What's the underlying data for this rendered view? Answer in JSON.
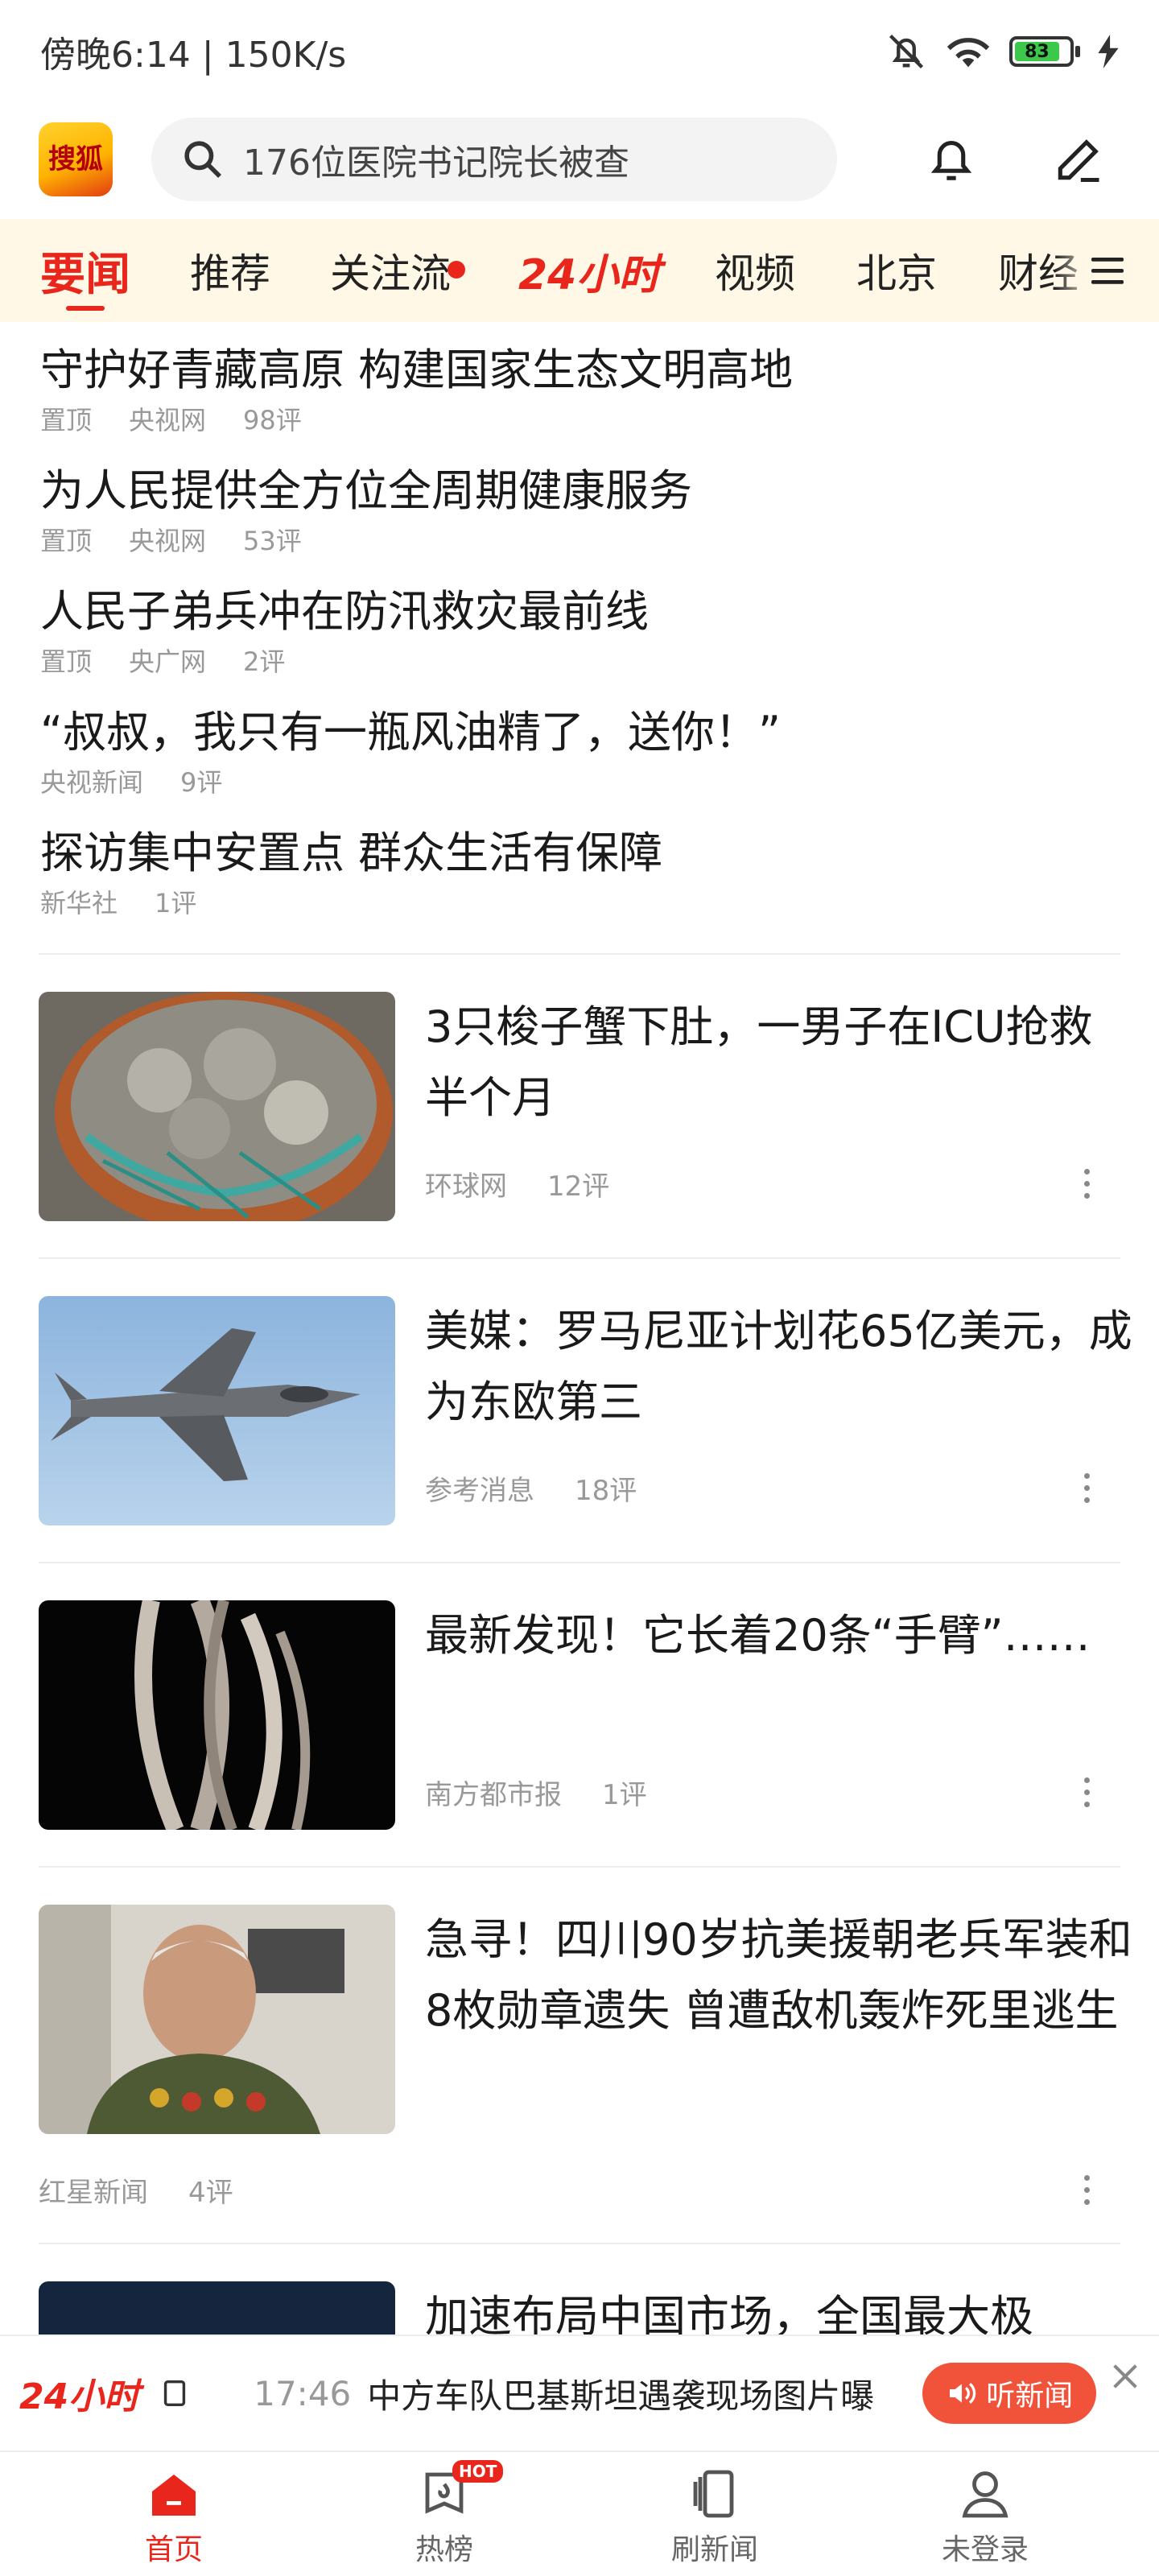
{
  "status_bar": {
    "left": "傍晚6:14 | 150K/s",
    "battery": "83"
  },
  "header": {
    "logo_text": "搜狐",
    "search_placeholder": "176位医院书记院长被查"
  },
  "tabs": [
    {
      "label": "要闻",
      "active": true
    },
    {
      "label": "推荐"
    },
    {
      "label": "关注流",
      "has_dot": true
    },
    {
      "label": "24小时",
      "styled": true
    },
    {
      "label": "视频"
    },
    {
      "label": "北京"
    },
    {
      "label": "财经"
    }
  ],
  "top_stories": [
    {
      "title": "守护好青藏高原 构建国家生态文明高地",
      "pin": "置顶",
      "source": "央视网",
      "comments": "98评"
    },
    {
      "title": "为人民提供全方位全周期健康服务",
      "pin": "置顶",
      "source": "央视网",
      "comments": "53评"
    },
    {
      "title": "人民子弟兵冲在防汛救灾最前线",
      "pin": "置顶",
      "source": "央广网",
      "comments": "2评"
    },
    {
      "title": "“叔叔，我只有一瓶风油精了，送你！”",
      "source": "央视新闻",
      "comments": "9评"
    },
    {
      "title": "探访集中安置点 群众生活有保障",
      "source": "新华社",
      "comments": "1评"
    }
  ],
  "image_stories": [
    {
      "title": "3只梭子蟹下肚，一男子在ICU抢救半个月",
      "source": "环球网",
      "comments": "12评",
      "thumb": "crab-thumbnail"
    },
    {
      "title": "美媒：罗马尼亚计划花65亿美元，成为东欧第三",
      "source": "参考消息",
      "comments": "18评",
      "thumb": "fighter-jet-thumbnail"
    },
    {
      "title": "最新发现！它长着20条“手臂”……",
      "source": "南方都市报",
      "comments": "1评",
      "thumb": "sea-creature-thumbnail"
    },
    {
      "title": "急寻！四川90岁抗美援朝老兵军装和8枚勋章遗失 曾遭敌机轰炸死里逃生",
      "source": "红星新闻",
      "comments": "4评",
      "thumb": "veteran-thumbnail"
    },
    {
      "title": "加速布局中国市场，全国最大极",
      "thumb": "dark-thumbnail"
    }
  ],
  "ticker": {
    "logo": "24小时",
    "time": "17:46",
    "text": "中方车队巴基斯坦遇袭现场图片曝",
    "listen_label": "听新闻"
  },
  "bottom_nav": [
    {
      "label": "首页",
      "active": true
    },
    {
      "label": "热榜",
      "badge": "HOT"
    },
    {
      "label": "刷新闻"
    },
    {
      "label": "未登录"
    }
  ],
  "colors": {
    "accent": "#e8261c",
    "tab_bg": "#fff8e6",
    "listen_button": "#f0533a"
  }
}
